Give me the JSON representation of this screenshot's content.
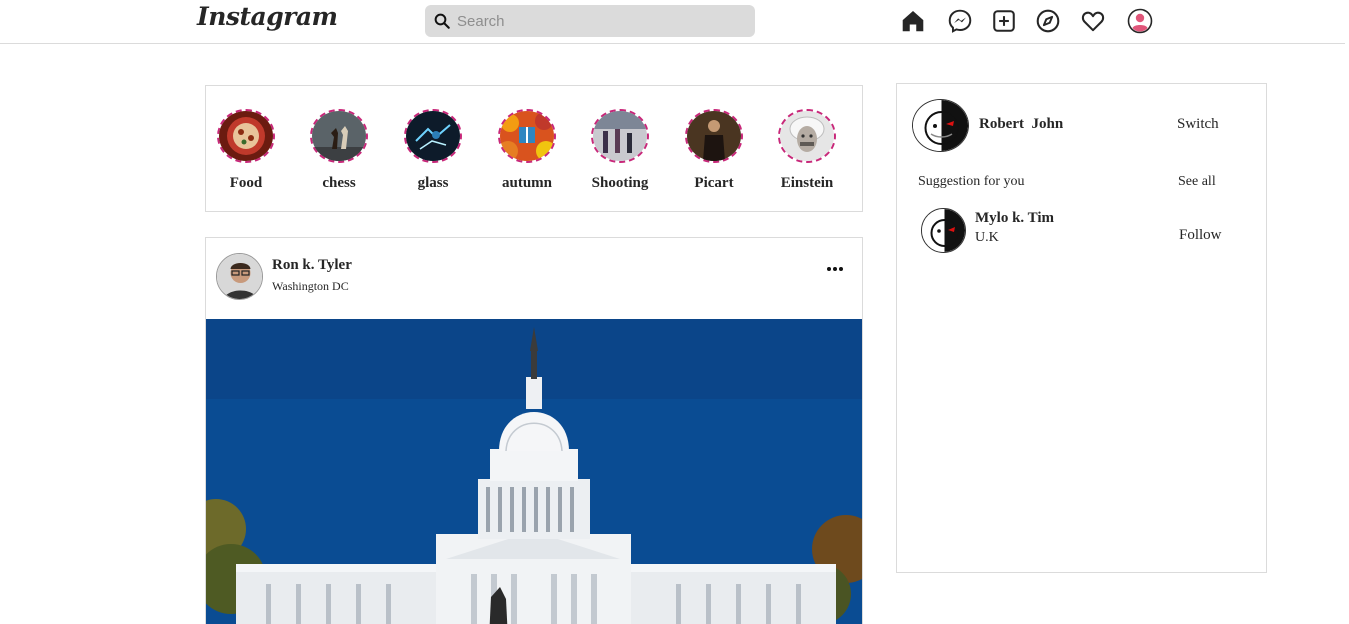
{
  "header": {
    "logo": "Instagram",
    "search": {
      "placeholder": "Search"
    },
    "icons": [
      "home-icon",
      "messenger-icon",
      "new-post-icon",
      "explore-icon",
      "activity-heart-icon",
      "profile-avatar-icon"
    ]
  },
  "stories": [
    {
      "label": "Food"
    },
    {
      "label": "chess"
    },
    {
      "label": "glass"
    },
    {
      "label": "autumn"
    },
    {
      "label": "Shooting"
    },
    {
      "label": "Picart"
    },
    {
      "label": "Einstein"
    }
  ],
  "post": {
    "username": "Ron k. Tyler",
    "location": "Washington DC"
  },
  "sidebar": {
    "user_name": "Robert  John",
    "switch_label": "Switch",
    "suggestion_title": "Suggestion for you",
    "see_all_label": "See all",
    "suggestions": [
      {
        "name": "Mylo k. Tim",
        "subtitle": "U.K",
        "action": "Follow"
      }
    ]
  },
  "colors": {
    "story_ring": "#c8287a",
    "border": "#dbdbdb",
    "search_bg": "#dbdbdb",
    "sky": "#0a4c93"
  }
}
